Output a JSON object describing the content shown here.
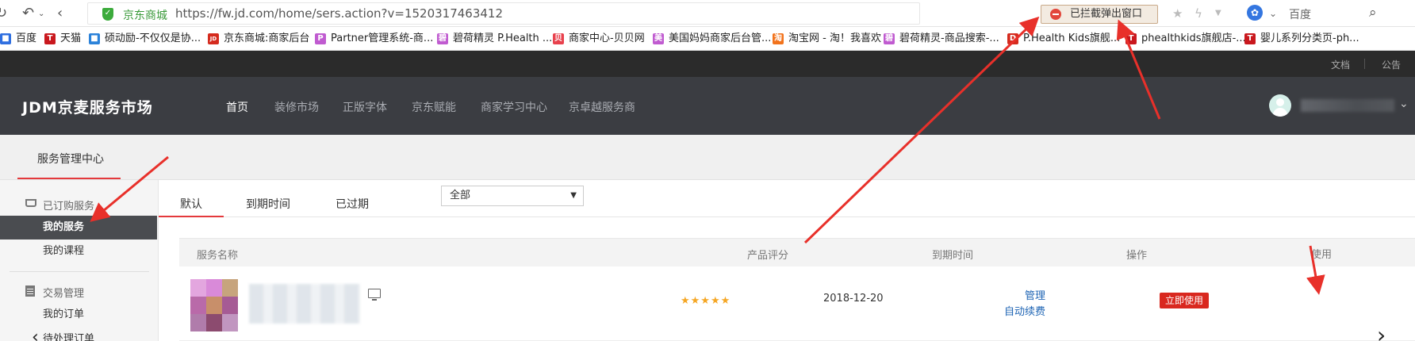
{
  "browser": {
    "site_name": "京东商城",
    "url": "https://fw.jd.com/home/sers.action?v=1520317463412",
    "popup_blocked": "已拦截弹出窗口",
    "search_engine": "百度",
    "icons": [
      "refresh-icon",
      "undo-icon",
      "back-icon",
      "shield-icon",
      "star-icon",
      "lightning-icon",
      "paw-icon",
      "search-icon"
    ]
  },
  "bookmarks": [
    {
      "label": "百度",
      "color": "#2f6fe0",
      "glyph": "■"
    },
    {
      "label": "天猫",
      "color": "#c9181e",
      "glyph": "T"
    },
    {
      "label": "硕动励-不仅仅是协...",
      "color": "#2b82d9",
      "glyph": "■"
    },
    {
      "label": "京东商城:商家后台",
      "color": "#d52b1e",
      "glyph": "JD"
    },
    {
      "label": "Partner管理系统-商...",
      "color": "#c05bd0",
      "glyph": "P"
    },
    {
      "label": "碧荷精灵 P.Health ...",
      "color": "#c05bd0",
      "glyph": "碧"
    },
    {
      "label": "商家中心-贝贝网",
      "color": "#e8414d",
      "glyph": "贝"
    },
    {
      "label": "美国妈妈商家后台管...",
      "color": "#c05bd0",
      "glyph": "美"
    },
    {
      "label": "淘宝网 - 淘！我喜欢",
      "color": "#f2731c",
      "glyph": "淘"
    },
    {
      "label": "碧荷精灵-商品搜索-...",
      "color": "#c05bd0",
      "glyph": "碧"
    },
    {
      "label": "P.Health Kids旗舰...",
      "color": "#d52b1e",
      "glyph": "D"
    },
    {
      "label": "phealthkids旗舰店-...",
      "color": "#c9181e",
      "glyph": "T"
    },
    {
      "label": "婴儿系列分类页-ph...",
      "color": "#c9181e",
      "glyph": "T"
    }
  ],
  "topstrip": {
    "docs": "文档",
    "notice": "公告"
  },
  "header": {
    "logo": "JDM京麦服务市场",
    "nav": [
      "首页",
      "装修市场",
      "正版字体",
      "京东赋能",
      "商家学习中心",
      "京卓越服务商"
    ]
  },
  "subheader": {
    "title": "服务管理中心"
  },
  "sidebar": {
    "section1": "已订购服务",
    "items1": [
      "我的服务",
      "我的课程"
    ],
    "section2": "交易管理",
    "items2": [
      "我的订单",
      "待处理订单"
    ]
  },
  "tabs": [
    "默认",
    "到期时间",
    "已过期"
  ],
  "filter": {
    "selected": "全部"
  },
  "table": {
    "headers": [
      "服务名称",
      "产品评分",
      "到期时间",
      "操作",
      "使用"
    ],
    "rows": [
      {
        "stars": "★★★★★",
        "rating": 5,
        "expiry": "2018-12-20",
        "manage": "管理",
        "auto_renew": "自动续费",
        "use": "立即使用"
      }
    ]
  },
  "colors": {
    "accent": "#e4393c",
    "use_button": "#d9281f",
    "link": "#1e64b4",
    "header_bg": "#3b3d42",
    "annotation_arrow": "#e8302a"
  }
}
